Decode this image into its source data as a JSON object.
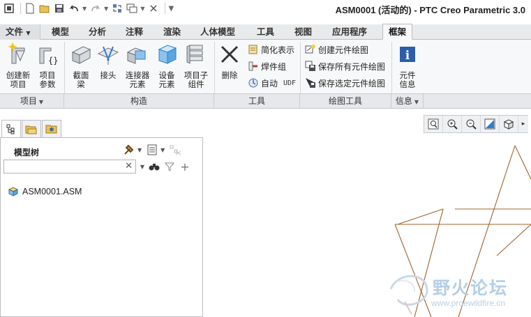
{
  "window": {
    "title": "ASM0001 (活动的) - PTC Creo Parametric 3.0"
  },
  "quick_access": [
    "new-icon",
    "open-icon",
    "save-icon",
    "undo-icon",
    "redo-icon",
    "regenerate-icon",
    "windows-icon",
    "close-window-icon",
    "customize-icon"
  ],
  "tabs": [
    {
      "label": "文件",
      "active": false
    },
    {
      "label": "模型",
      "active": false
    },
    {
      "label": "分析",
      "active": false
    },
    {
      "label": "注释",
      "active": false
    },
    {
      "label": "渲染",
      "active": false
    },
    {
      "label": "人体模型",
      "active": false
    },
    {
      "label": "工具",
      "active": false
    },
    {
      "label": "视图",
      "active": false
    },
    {
      "label": "应用程序",
      "active": false
    },
    {
      "label": "框架",
      "active": true
    }
  ],
  "ribbon": {
    "buttons": {
      "create_item": [
        "创建新",
        "项目"
      ],
      "item_params": [
        "项目",
        "参数"
      ],
      "section_beam": [
        "截面",
        "梁"
      ],
      "joint": [
        "接头"
      ],
      "connector": [
        "连接器",
        "元素"
      ],
      "equipment": [
        "设备",
        "元素"
      ],
      "sub_item": [
        "项目子",
        "组件"
      ],
      "delete": [
        "删除"
      ],
      "simplify": "简化表示",
      "weld_group": "焊件组",
      "auto_udf": "自动",
      "udf_tag": "UDF",
      "create_drawing": "创建元件绘图",
      "save_all_drawings": "保存所有元件绘图",
      "save_selected_drawings": "保存选定元件绘图",
      "component_info": [
        "元件",
        "信息"
      ]
    },
    "groups": {
      "item": "项目",
      "construct": "构造",
      "tools": "工具",
      "drawing_tools": "绘图工具",
      "info": "信息"
    }
  },
  "navigator": {
    "tree_title": "模型树",
    "search_value": "",
    "root_item": "ASM0001.ASM"
  },
  "watermark": {
    "text": "野火论坛",
    "url": "www.proewildfire.cn"
  },
  "colors": {
    "accent": "#1f5fa8",
    "datum_lines": "#a0622a"
  }
}
